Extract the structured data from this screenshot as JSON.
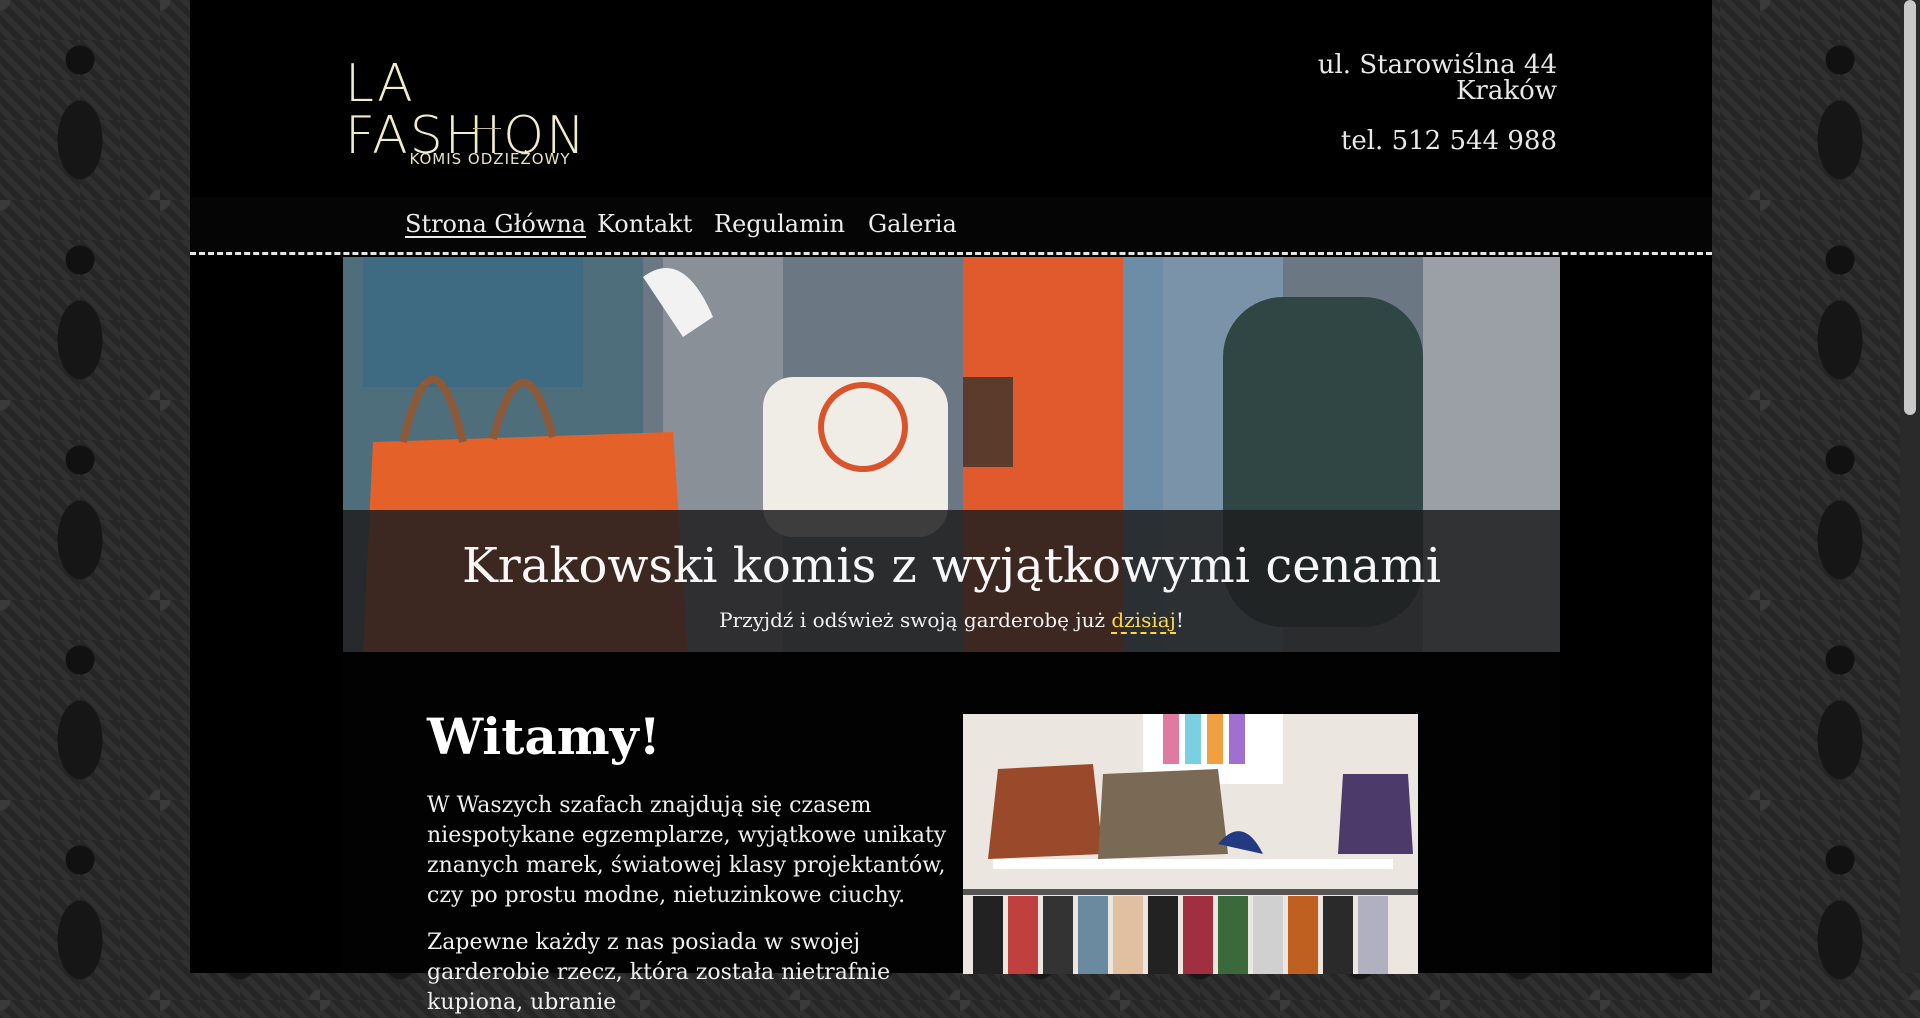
{
  "logo": {
    "main": "LA FASHION",
    "sub": "KOMIS ODZIEŻOWY"
  },
  "contact": {
    "street": "ul. Starowiślna 44",
    "city": "Kraków",
    "phone": "tel. 512 544 988"
  },
  "nav": {
    "items": [
      {
        "label": "Strona Główna",
        "active": true
      },
      {
        "label": "Kontakt"
      },
      {
        "label": "Regulamin"
      },
      {
        "label": "Galeria"
      }
    ]
  },
  "hero": {
    "title": "Krakowski komis z wyjątkowymi cenami",
    "sub_before": "Przyjdź i odśwież swoją garderobę już ",
    "sub_link": "dzisiaj",
    "sub_after": "!"
  },
  "main": {
    "title": "Witamy!",
    "paragraphs": [
      "W Waszych szafach znajdują się czasem niespotykane egzemplarze, wyjątkowe unikaty znanych marek, światowej klasy projektantów, czy po prostu modne, nietuzinkowe ciuchy.",
      "Zapewne każdy z nas posiada w swojej garderobie rzecz, która została nietrafnie kupiona, ubranie"
    ]
  },
  "colors": {
    "background": "#000000",
    "accent_link": "#ffd54a",
    "logo": "#f2ecc8",
    "text": "#f0f0f0"
  }
}
